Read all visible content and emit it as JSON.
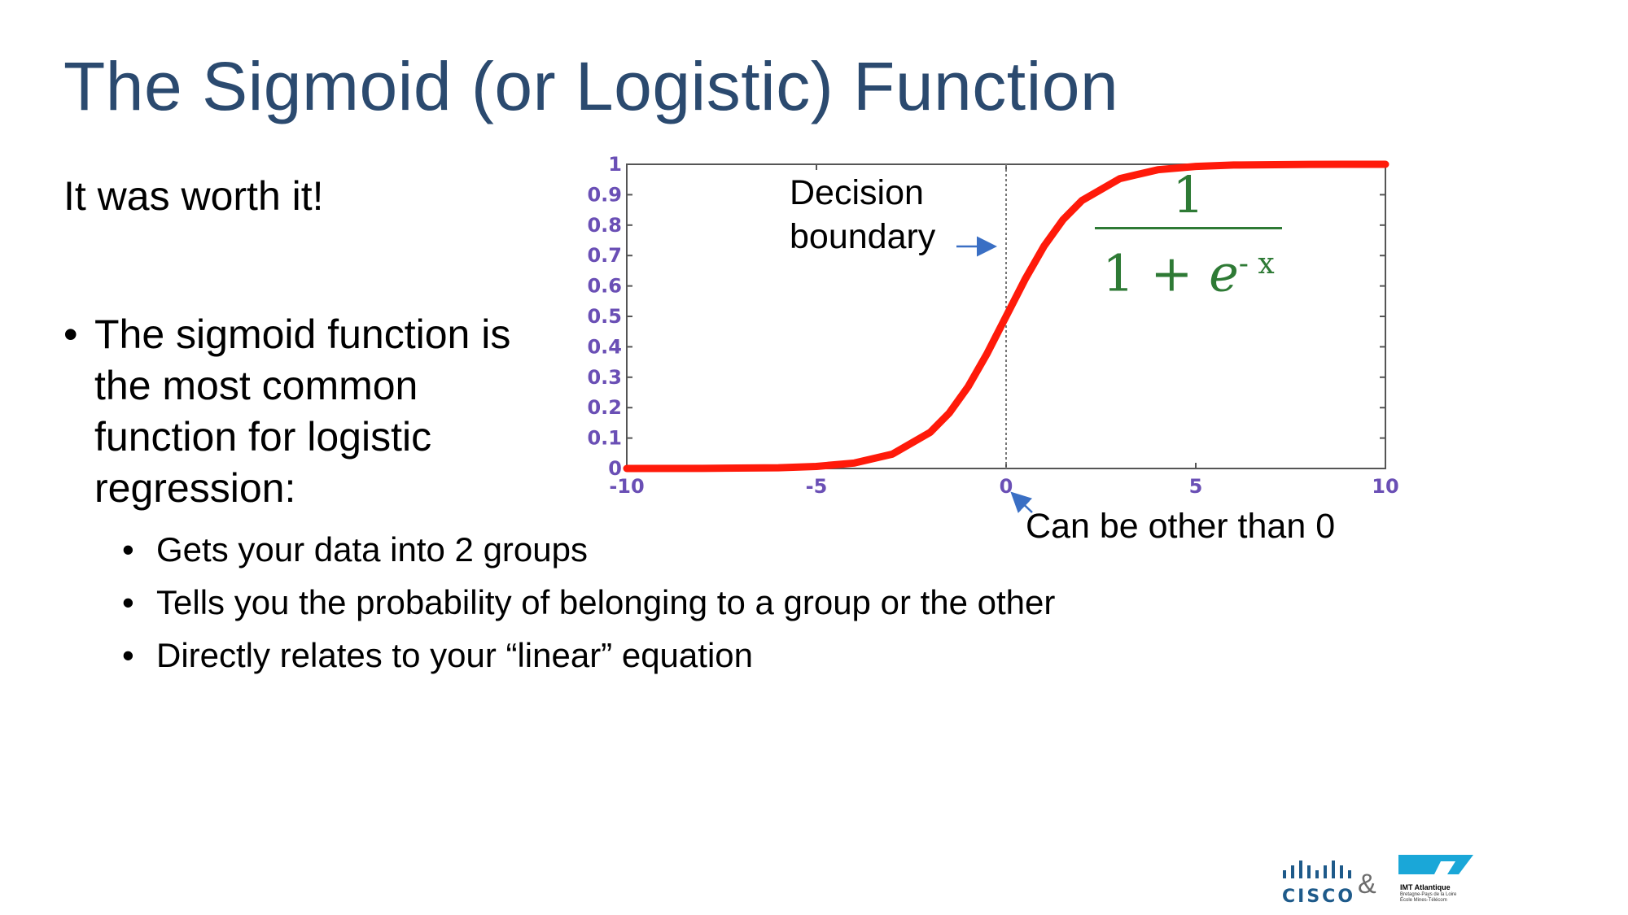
{
  "slide": {
    "title": "The Sigmoid (or Logistic) Function",
    "subtitle": "It was worth it!",
    "bullet": "The sigmoid function is the most common function for logistic regression:",
    "bullet_marker": "•",
    "sub_bullets": [
      "Gets your data into 2 groups",
      "Tells you the probability of belonging to a group or the other",
      "Directly relates to your “linear” equation"
    ]
  },
  "annotations": {
    "decision_boundary_line1": "Decision",
    "decision_boundary_line2": "boundary",
    "other_than_zero": "Can be other than 0",
    "formula_numerator": "1",
    "formula_denominator_base": "1 + ",
    "formula_denominator_e": "e",
    "formula_denominator_exp": "- x"
  },
  "logos": {
    "cisco": "CISCO",
    "ampersand": "&",
    "imt_name": "IMT Atlantique",
    "imt_sub1": "Bretagne-Pays de la Loire",
    "imt_sub2": "École Mines-Télécom"
  },
  "colors": {
    "title": "#2b4a6f",
    "curve": "#ff1a0a",
    "tick_labels": "#6a4fb5",
    "formula": "#2e7a35",
    "arrow": "#3a6fc4"
  },
  "chart_data": {
    "type": "line",
    "title": "",
    "xlabel": "",
    "ylabel": "",
    "xlim": [
      -10,
      10
    ],
    "ylim": [
      0,
      1
    ],
    "x_ticks": [
      -10,
      -5,
      0,
      5,
      10
    ],
    "x_tick_labels": [
      "-10",
      "-5",
      "0",
      "5",
      "10"
    ],
    "y_ticks": [
      0,
      0.1,
      0.2,
      0.3,
      0.4,
      0.5,
      0.6,
      0.7,
      0.8,
      0.9,
      1
    ],
    "y_tick_labels": [
      "0",
      "0.1",
      "0.2",
      "0.3",
      "0.4",
      "0.5",
      "0.6",
      "0.7",
      "0.8",
      "0.9",
      "1"
    ],
    "grid": false,
    "vertical_line_x": 0,
    "series": [
      {
        "function": "1/(1+exp(-x))",
        "x": [
          -10,
          -8,
          -6,
          -5,
          -4,
          -3,
          -2,
          -1.5,
          -1,
          -0.5,
          0,
          0.5,
          1,
          1.5,
          2,
          3,
          4,
          5,
          6,
          8,
          10
        ],
        "y": [
          0.0,
          0.0003,
          0.0025,
          0.0067,
          0.018,
          0.047,
          0.119,
          0.182,
          0.269,
          0.378,
          0.5,
          0.622,
          0.731,
          0.818,
          0.881,
          0.953,
          0.982,
          0.993,
          0.9975,
          0.9997,
          1.0
        ]
      }
    ]
  }
}
